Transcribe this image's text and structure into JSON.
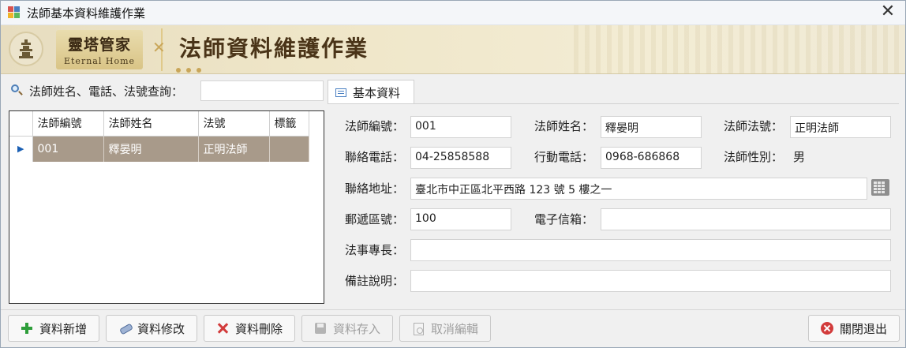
{
  "window": {
    "title": "法師基本資料維護作業",
    "close_glyph": "✕"
  },
  "banner": {
    "brand_name": "靈塔管家",
    "brand_sub": "Eternal Home",
    "title": "法師資料維護作業"
  },
  "search": {
    "label": "法師姓名、電話、法號查詢：",
    "value": ""
  },
  "grid": {
    "columns": [
      "法師編號",
      "法師姓名",
      "法號",
      "標籤"
    ],
    "rows": [
      {
        "indicator": "▶",
        "cells": [
          "001",
          "釋晏明",
          "正明法師",
          ""
        ]
      }
    ],
    "selected_row_color": "#a89a8a"
  },
  "tab": {
    "label": "基本資料"
  },
  "form": {
    "id_label": "法師編號：",
    "id_value": "001",
    "name_label": "法師姓名：",
    "name_value": "釋晏明",
    "dharma_label": "法師法號：",
    "dharma_value": "正明法師",
    "phone_label": "聯絡電話：",
    "phone_value": "04-25858588",
    "mobile_label": "行動電話：",
    "mobile_value": "0968-686868",
    "gender_label": "法師性別：",
    "gender_value": "男",
    "address_label": "聯絡地址：",
    "address_value": "臺北市中正區北平西路 123 號 5 樓之一",
    "zip_label": "郵遞區號：",
    "zip_value": "100",
    "email_label": "電子信箱：",
    "email_value": "",
    "specialty_label": "法事專長：",
    "specialty_value": "",
    "note_label": "備註說明：",
    "note_value": ""
  },
  "toolbar": {
    "add_label": "資料新增",
    "edit_label": "資料修改",
    "delete_label": "資料刪除",
    "save_label": "資料存入",
    "cancel_label": "取消編輯",
    "exit_label": "關閉退出"
  },
  "icons": {
    "app": "app-icon",
    "search": "search-icon",
    "tab": "form-icon",
    "keypad": "keypad-icon",
    "add": "plus-icon",
    "edit": "eraser-icon",
    "delete": "delete-x-icon",
    "save": "floppy-disk-icon",
    "cancel": "document-icon",
    "exit": "close-circle-icon"
  },
  "colors": {
    "banner_bg": "#efe6c8",
    "selected_row": "#a89a8a",
    "add_icon": "#2e9e3a",
    "delete_icon": "#d23b3b"
  }
}
